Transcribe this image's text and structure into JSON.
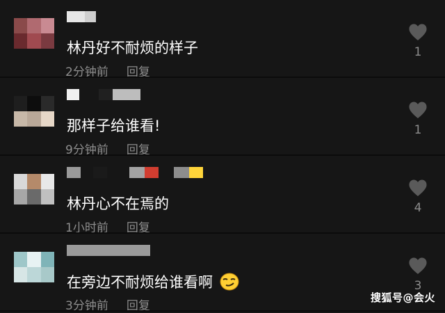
{
  "comments": [
    {
      "text": "林丹好不耐烦的样子",
      "time": "2分钟前",
      "reply_label": "回复",
      "likes": "1",
      "avatar_colors": [
        "#8a4a4a",
        "#b06a70",
        "#c98a92",
        "#6a2a2e",
        "#a04a50",
        "#7a3a40"
      ],
      "name_blocks": [
        "#e6e6e6",
        "#cfcfcf"
      ],
      "emoji": null
    },
    {
      "text": "那样子给谁看!",
      "time": "9分钟前",
      "reply_label": "回复",
      "likes": "1",
      "avatar_colors": [
        "#1e1e1e",
        "#0d0d0d",
        "#2a2a2a",
        "#c7b8a8",
        "#b9a898",
        "#e6d7c7"
      ],
      "name_blocks": [
        "#f0f0f0",
        "#202020",
        "#bdbdbd"
      ],
      "emoji": null
    },
    {
      "text": "林丹心不在焉的",
      "time": "1小时前",
      "reply_label": "回复",
      "likes": "4",
      "avatar_colors": [
        "#d9d9d9",
        "#b58a6a",
        "#e8e8e8",
        "#a7a7a7",
        "#6a6a6a",
        "#c0c0c0"
      ],
      "name_blocks": [
        "#9a9a9a",
        "#1a1a1a",
        "#a3a3a3",
        "#d13d30",
        "#8d8d8d",
        "#ffd53a"
      ],
      "emoji": null
    },
    {
      "text": "在旁边不耐烦给谁看啊",
      "time": "3分钟前",
      "reply_label": "回复",
      "likes": "3",
      "avatar_colors": [
        "#9ec7c9",
        "#e7f2f3",
        "#7fb4b8",
        "#d7e6e6",
        "#bcd7d8",
        "#a8c9c9"
      ],
      "name_blocks": [
        "#9a9a9a"
      ],
      "emoji": "smirk-emoji"
    }
  ],
  "watermark": "搜狐号@会火",
  "colors": {
    "background": "#161616",
    "text": "#ffffff",
    "meta_text": "#8d8d8d",
    "heart": "#5a5a5a",
    "emoji_face": "#ffcf33"
  }
}
